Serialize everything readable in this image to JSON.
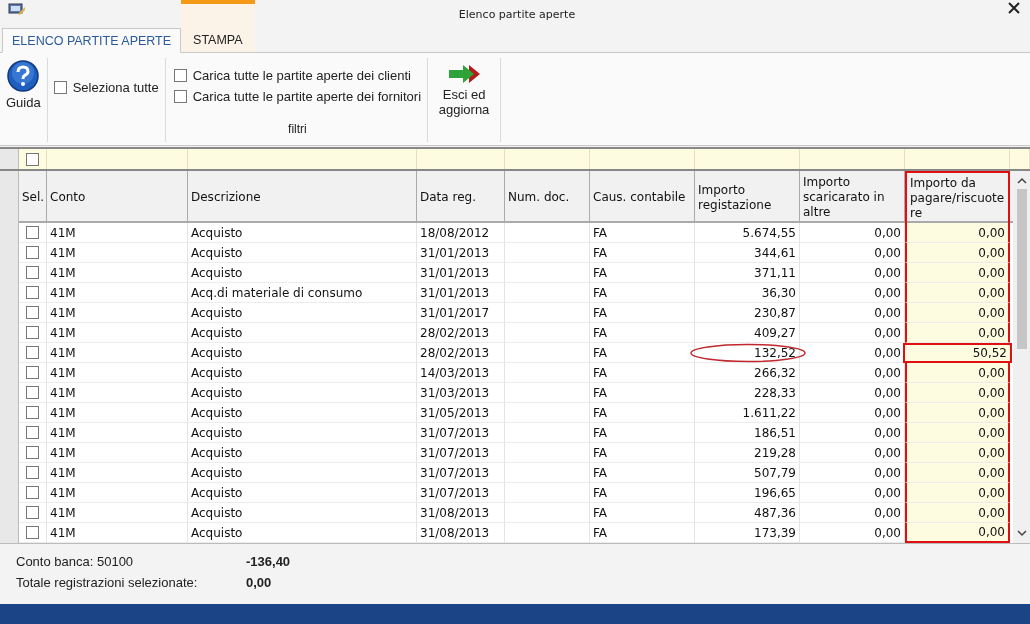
{
  "window": {
    "title": "Elenco partite aperte"
  },
  "tabs": [
    {
      "label": "ELENCO PARTITE APERTE",
      "selected": true
    },
    {
      "label": "STAMPA",
      "selected": false
    }
  ],
  "ribbon": {
    "help_button": "Guida",
    "select_all": {
      "label": "Seleziona tutte",
      "checked": false
    },
    "filters": [
      {
        "label": "Carica tutte le partite aperte dei clienti",
        "checked": false
      },
      {
        "label": "Carica tutte le partite aperte dei fornitori",
        "checked": false
      }
    ],
    "filter_group": "filtri",
    "exit_button": "Esci ed aggiorna"
  },
  "filter_row": {
    "checked": false
  },
  "columns": [
    {
      "label": "Sel.",
      "highlighted": false
    },
    {
      "label": "Conto",
      "highlighted": false
    },
    {
      "label": "Descrizione",
      "highlighted": false
    },
    {
      "label": "Data reg.",
      "highlighted": false
    },
    {
      "label": "Num. doc.",
      "highlighted": false
    },
    {
      "label": "Caus. contabile",
      "highlighted": false
    },
    {
      "label": "Importo registazione",
      "highlighted": false
    },
    {
      "label": "Importo scaricarato in altre",
      "highlighted": false
    },
    {
      "label": "Importo da pagare/riscuotere",
      "highlighted": true
    }
  ],
  "rows": [
    {
      "selected": false,
      "conto": "41M",
      "descrizione": "Acquisto",
      "data": "18/08/2012",
      "caus": "FA",
      "importo": "5.674,55",
      "scaricato": "0,00",
      "da_pagare": "0,00",
      "marked": false
    },
    {
      "selected": false,
      "conto": "41M",
      "descrizione": "Acquisto",
      "data": "31/01/2013",
      "caus": "FA",
      "importo": "344,61",
      "scaricato": "0,00",
      "da_pagare": "0,00",
      "marked": false
    },
    {
      "selected": false,
      "conto": "41M",
      "descrizione": "Acquisto",
      "data": "31/01/2013",
      "caus": "FA",
      "importo": "371,11",
      "scaricato": "0,00",
      "da_pagare": "0,00",
      "marked": false
    },
    {
      "selected": false,
      "conto": "41M",
      "descrizione": "Acq.di materiale di consumo",
      "data": "31/01/2013",
      "caus": "FA",
      "importo": "36,30",
      "scaricato": "0,00",
      "da_pagare": "0,00",
      "marked": false
    },
    {
      "selected": false,
      "conto": "41M",
      "descrizione": "Acquisto",
      "data": "31/01/2017",
      "caus": "FA",
      "importo": "230,87",
      "scaricato": "0,00",
      "da_pagare": "0,00",
      "marked": false
    },
    {
      "selected": false,
      "conto": "41M",
      "descrizione": "Acquisto",
      "data": "28/02/2013",
      "caus": "FA",
      "importo": "409,27",
      "scaricato": "0,00",
      "da_pagare": "0,00",
      "marked": false
    },
    {
      "selected": false,
      "conto": "41M",
      "descrizione": "Acquisto",
      "data": "28/02/2013",
      "caus": "FA",
      "importo": "132,52",
      "scaricato": "0,00",
      "da_pagare": "50,52",
      "marked": true
    },
    {
      "selected": false,
      "conto": "41M",
      "descrizione": "Acquisto",
      "data": "14/03/2013",
      "caus": "FA",
      "importo": "266,32",
      "scaricato": "0,00",
      "da_pagare": "0,00",
      "marked": false
    },
    {
      "selected": false,
      "conto": "41M",
      "descrizione": "Acquisto",
      "data": "31/03/2013",
      "caus": "FA",
      "importo": "228,33",
      "scaricato": "0,00",
      "da_pagare": "0,00",
      "marked": false
    },
    {
      "selected": false,
      "conto": "41M",
      "descrizione": "Acquisto",
      "data": "31/05/2013",
      "caus": "FA",
      "importo": "1.611,22",
      "scaricato": "0,00",
      "da_pagare": "0,00",
      "marked": false
    },
    {
      "selected": false,
      "conto": "41M",
      "descrizione": "Acquisto",
      "data": "31/07/2013",
      "caus": "FA",
      "importo": "186,51",
      "scaricato": "0,00",
      "da_pagare": "0,00",
      "marked": false
    },
    {
      "selected": false,
      "conto": "41M",
      "descrizione": "Acquisto",
      "data": "31/07/2013",
      "caus": "FA",
      "importo": "219,28",
      "scaricato": "0,00",
      "da_pagare": "0,00",
      "marked": false
    },
    {
      "selected": false,
      "conto": "41M",
      "descrizione": "Acquisto",
      "data": "31/07/2013",
      "caus": "FA",
      "importo": "507,79",
      "scaricato": "0,00",
      "da_pagare": "0,00",
      "marked": false
    },
    {
      "selected": false,
      "conto": "41M",
      "descrizione": "Acquisto",
      "data": "31/07/2013",
      "caus": "FA",
      "importo": "196,65",
      "scaricato": "0,00",
      "da_pagare": "0,00",
      "marked": false
    },
    {
      "selected": false,
      "conto": "41M",
      "descrizione": "Acquisto",
      "data": "31/08/2013",
      "caus": "FA",
      "importo": "487,36",
      "scaricato": "0,00",
      "da_pagare": "0,00",
      "marked": false
    },
    {
      "selected": false,
      "conto": "41M",
      "descrizione": "Acquisto",
      "data": "31/08/2013",
      "caus": "FA",
      "importo": "173,39",
      "scaricato": "0,00",
      "da_pagare": "0,00",
      "marked": false
    }
  ],
  "footer": [
    {
      "label": "Conto banca: 50100",
      "value": "-136,40"
    },
    {
      "label": "Totale registrazioni selezionate:",
      "value": "0,00"
    }
  ]
}
